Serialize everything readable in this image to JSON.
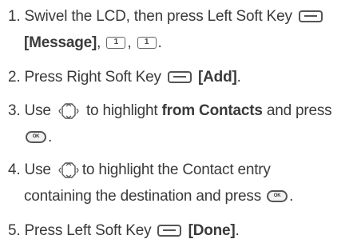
{
  "steps": [
    {
      "num": "1.",
      "text_a": "Swivel the LCD, then press Left Soft Key",
      "bold_b": "[Message]",
      "sep": ",",
      "key_1": "1",
      "end": "."
    },
    {
      "num": "2.",
      "text_a": "Press Right Soft Key",
      "bold_b": "[Add]",
      "end": "."
    },
    {
      "num": "3.",
      "text_a": "Use",
      "text_b": "to highlight",
      "bold_c": "from Contacts",
      "text_d": "and press",
      "end": "."
    },
    {
      "num": "4.",
      "text_a": "Use",
      "text_b": "to highlight the Contact entry",
      "text_c": "containing the destination and press",
      "end": "."
    },
    {
      "num": "5.",
      "text_a": "Press  Left Soft Key",
      "bold_b": "[Done]",
      "end": "."
    }
  ],
  "icons": {
    "soft_key": "soft-key-icon",
    "number_key": "number-key-1-icon",
    "ok_key": "ok-key-icon",
    "nav_key": "navigation-key-icon",
    "ok_label": "OK"
  }
}
